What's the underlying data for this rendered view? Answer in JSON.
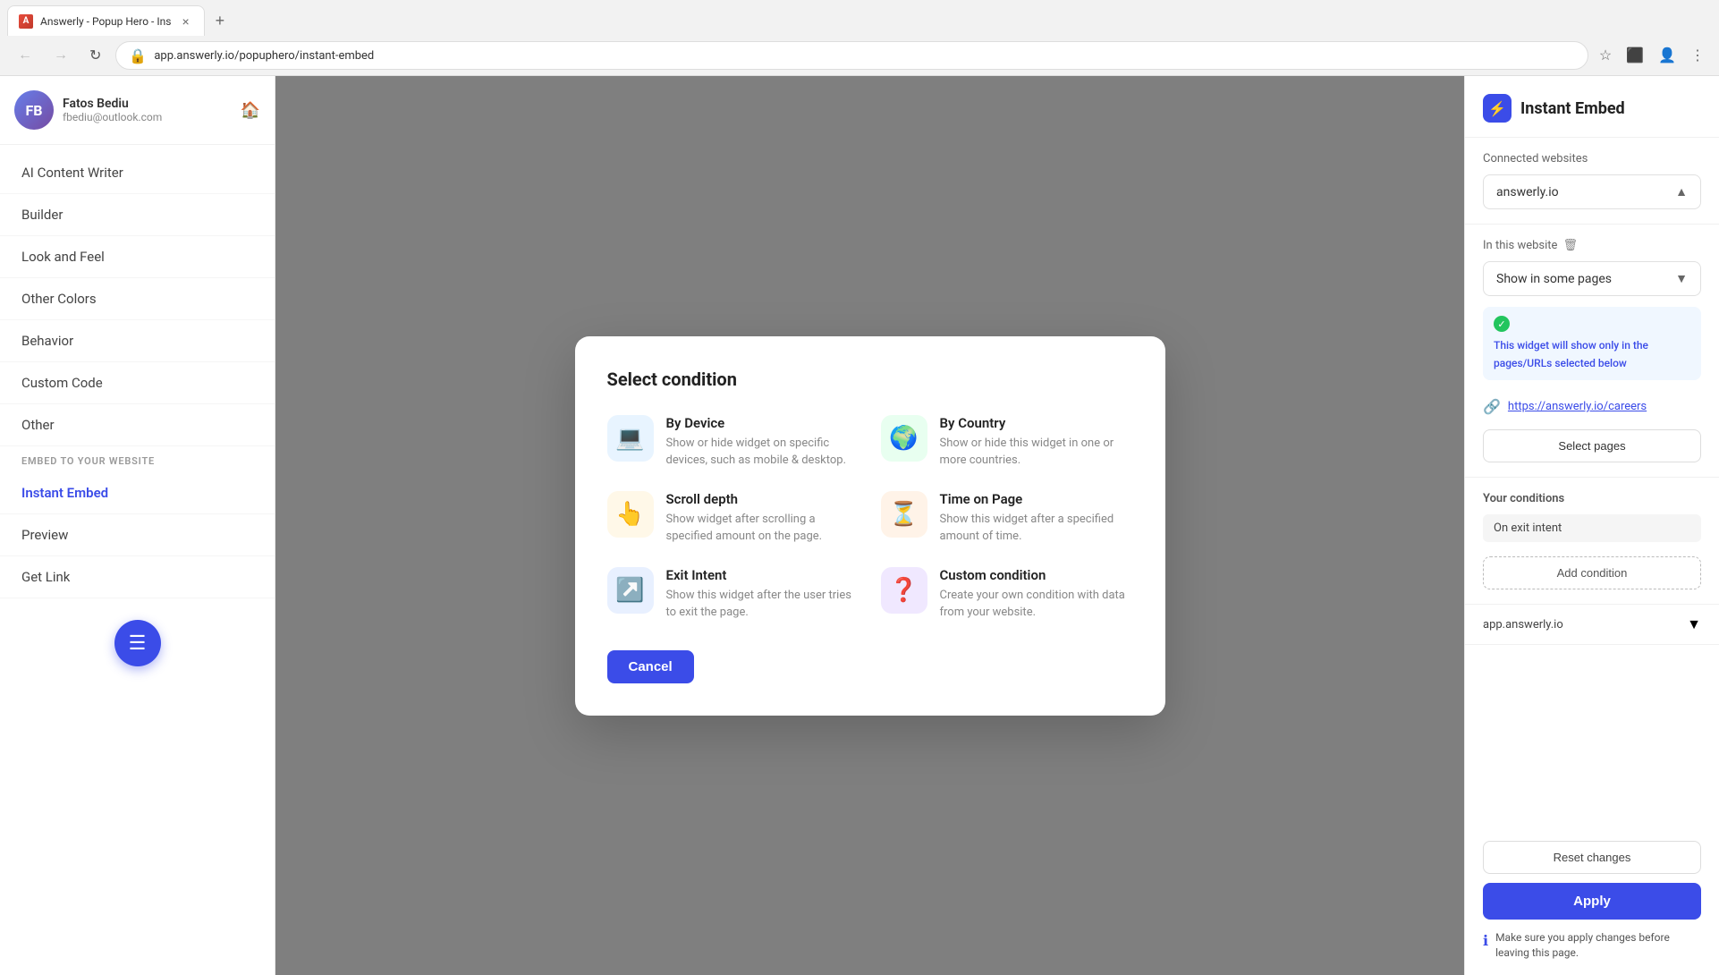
{
  "browser": {
    "tab_label": "Answerly - Popup Hero - Ins",
    "url": "app.answerly.io/popuphero/instant-embed",
    "new_tab_label": "+"
  },
  "sidebar": {
    "user": {
      "name": "Fatos Bediu",
      "email": "fbediu@outlook.com",
      "initials": "FB"
    },
    "nav_items": [
      {
        "label": "AI Content Writer",
        "active": false
      },
      {
        "label": "Builder",
        "active": false
      },
      {
        "label": "Look and Feel",
        "active": false
      },
      {
        "label": "Other Colors",
        "active": false
      },
      {
        "label": "Behavior",
        "active": false
      },
      {
        "label": "Custom Code",
        "active": false
      },
      {
        "label": "Other",
        "active": false
      }
    ],
    "embed_section_label": "EMBED TO YOUR WEBSITE",
    "embed_items": [
      {
        "label": "Instant Embed",
        "active": true
      },
      {
        "label": "Preview",
        "active": false
      },
      {
        "label": "Get Link",
        "active": false
      }
    ]
  },
  "right_panel": {
    "title": "Instant Embed",
    "icon": "⚡",
    "connected_websites_label": "Connected websites",
    "selected_website": "answerly.io",
    "in_this_website_label": "In this website",
    "trash_icon": "🗑",
    "show_option": "Show in some pages",
    "info_text": "This widget will show only in the pages/URLs selected below",
    "link_text": "https://answerly.io/careers",
    "select_pages_btn": "Select pages",
    "conditions_label": "Your conditions",
    "condition_tag": "On exit intent",
    "add_condition_btn": "Add condition",
    "collapsed_website": "app.answerly.io",
    "reset_btn": "Reset changes",
    "apply_btn": "Apply",
    "info_notice": "Make sure you apply changes before leaving this page."
  },
  "modal": {
    "title": "Select condition",
    "conditions": [
      {
        "id": "by-device",
        "icon": "💻",
        "icon_class": "icon-device",
        "title": "By Device",
        "desc": "Show or hide widget on specific devices, such as mobile & desktop."
      },
      {
        "id": "by-country",
        "icon": "🌍",
        "icon_class": "icon-country",
        "title": "By Country",
        "desc": "Show or hide this widget in one or more countries."
      },
      {
        "id": "scroll-depth",
        "icon": "👆",
        "icon_class": "icon-scroll",
        "title": "Scroll depth",
        "desc": "Show widget after scrolling a specified amount on the page."
      },
      {
        "id": "time-on-page",
        "icon": "⏳",
        "icon_class": "icon-time",
        "title": "Time on Page",
        "desc": "Show this widget after a specified amount of time."
      },
      {
        "id": "exit-intent",
        "icon": "↗",
        "icon_class": "icon-exit",
        "title": "Exit Intent",
        "desc": "Show this widget after the user tries to exit the page."
      },
      {
        "id": "custom-condition",
        "icon": "❓",
        "icon_class": "icon-custom",
        "title": "Custom condition",
        "desc": "Create your own condition with data from your website."
      }
    ],
    "cancel_btn": "Cancel"
  }
}
